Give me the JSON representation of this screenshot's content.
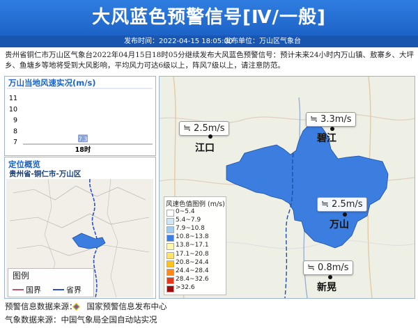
{
  "header": {
    "title": "大风蓝色预警信号[Ⅳ/一般]",
    "publish_time_label": "发布时间：2022-04-15 18:05:00",
    "publish_unit_label": "发布单位：万山区气象台"
  },
  "description": "贵州省铜仁市万山区气象台2022年04月15日18时05分继续发布大风蓝色预警信号：预计未来24小时内万山镇、敖寨乡、大坪乡、鱼塘乡等地将受到大风影响，平均风力可达6级以上，阵风7级以上，请注意防范。",
  "wind_panel": {
    "title": "万山当地风速实况(m/s)"
  },
  "chart_data": {
    "type": "scatter",
    "title": "万山当地风速实况(m/s)",
    "categories": [
      "18时"
    ],
    "values": [
      7.3
    ],
    "y_ticks": [
      7,
      8,
      9,
      10,
      11
    ],
    "ylim": [
      7,
      11
    ],
    "point_label": "7.3"
  },
  "overview": {
    "title": "定位概览",
    "location": "贵州省-铜仁市-万山区",
    "legend_title": "图例",
    "legend_items": [
      {
        "label": "国界",
        "color": "#c0556a"
      },
      {
        "label": "省界",
        "color": "#2a52be"
      }
    ]
  },
  "map": {
    "area_color": "#3c7de0",
    "stations": [
      {
        "name": "江口",
        "speed": "2.5m/s"
      },
      {
        "name": "碧江",
        "speed": "3.3m/s"
      },
      {
        "name": "万山",
        "speed": "2.5m/s"
      },
      {
        "name": "新晃",
        "speed": "0.8m/s"
      }
    ],
    "legend": {
      "title": "风速色值图例 (m/s)",
      "items": [
        {
          "label": "0~5.4",
          "color": "#ffffff"
        },
        {
          "label": "5.4~7.9",
          "color": "#cfe6f7"
        },
        {
          "label": "7.9~10.8",
          "color": "#9fcdf0"
        },
        {
          "label": "10.8~13.8",
          "color": "#3c7de0"
        },
        {
          "label": "13.8~17.1",
          "color": "#fff6b0"
        },
        {
          "label": "17.1~20.8",
          "color": "#ffe36b"
        },
        {
          "label": "20.8~24.4",
          "color": "#ffc21a"
        },
        {
          "label": "24.4~28.4",
          "color": "#ff8a1a"
        },
        {
          "label": "28.4~32.6",
          "color": "#e23a1a"
        },
        {
          "label": ">32.6",
          "color": "#9b0e0e"
        }
      ]
    }
  },
  "footer": {
    "warning_source": "预警信息数据来源：",
    "warning_source_name": "国家预警信息发布中心",
    "weather_source": "气象数据来源：中国气象局全国自动站实况"
  }
}
